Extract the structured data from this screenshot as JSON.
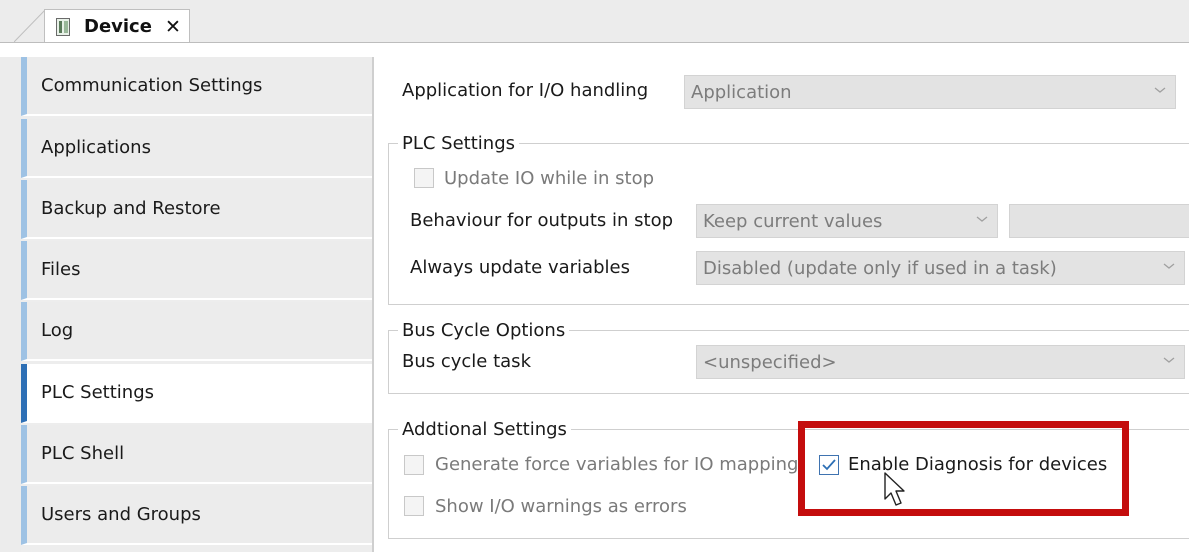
{
  "tab": {
    "title": "Device",
    "close_glyph": "✕"
  },
  "sidebar": {
    "items": [
      {
        "label": "Communication Settings"
      },
      {
        "label": "Applications"
      },
      {
        "label": "Backup and Restore"
      },
      {
        "label": "Files"
      },
      {
        "label": "Log"
      },
      {
        "label": "PLC Settings",
        "selected": true
      },
      {
        "label": "PLC Shell"
      },
      {
        "label": "Users and Groups"
      }
    ]
  },
  "main": {
    "io_app": {
      "label": "Application for I/O handling",
      "value": "Application"
    },
    "plc_settings": {
      "legend": "PLC Settings",
      "update_io": {
        "label": "Update IO while in stop",
        "checked": false
      },
      "behaviour": {
        "label": "Behaviour for outputs in stop",
        "value": "Keep current values",
        "extra_value": ""
      },
      "always_update": {
        "label": "Always update variables",
        "value": "Disabled (update only if used in a task)"
      }
    },
    "bus_cycle": {
      "legend": "Bus Cycle Options",
      "task": {
        "label": "Bus cycle task",
        "value": "<unspecified>"
      }
    },
    "additional": {
      "legend": "Addtional Settings",
      "force_vars": {
        "label": "Generate force variables for IO mapping",
        "checked": false
      },
      "io_warnings": {
        "label": "Show I/O warnings as errors",
        "checked": false
      },
      "diagnosis": {
        "label": "Enable Diagnosis for devices",
        "checked": true
      }
    }
  },
  "colors": {
    "accent_selected": "#2d6fb5",
    "accent_item": "#9ec2e4",
    "highlight": "#c40d0d"
  },
  "icons": [
    "device-icon",
    "close-icon",
    "chevron-down-icon",
    "checkmark-icon",
    "mouse-cursor-icon"
  ]
}
